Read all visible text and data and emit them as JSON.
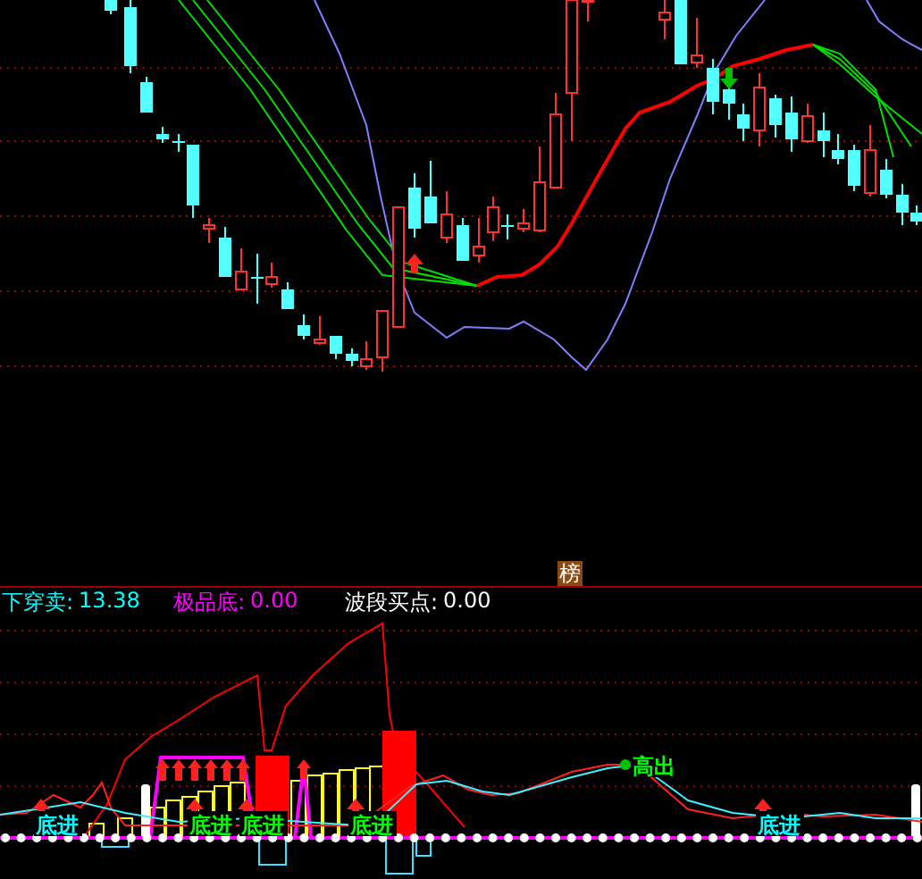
{
  "badge": {
    "text": "榜"
  },
  "legend": [
    {
      "label": "下穿卖:",
      "value": "13.38",
      "color": "#00ffff"
    },
    {
      "label": "极品底:",
      "value": "0.00",
      "color": "#ff00ff"
    },
    {
      "label": "波段买点:",
      "value": "0.00",
      "color": "#ffffff"
    }
  ],
  "signals": [
    {
      "text": "底进",
      "kind": "buy",
      "color": "#00ffff"
    },
    {
      "text": "底进",
      "kind": "buy",
      "color": "#00ff00"
    },
    {
      "text": "底进",
      "kind": "buy",
      "color": "#00ff00"
    },
    {
      "text": "底进",
      "kind": "buy",
      "color": "#00ff00"
    },
    {
      "text": "高出",
      "kind": "sell",
      "color": "#00ff00"
    },
    {
      "text": "底进",
      "kind": "buy",
      "color": "#00ffff"
    }
  ]
}
